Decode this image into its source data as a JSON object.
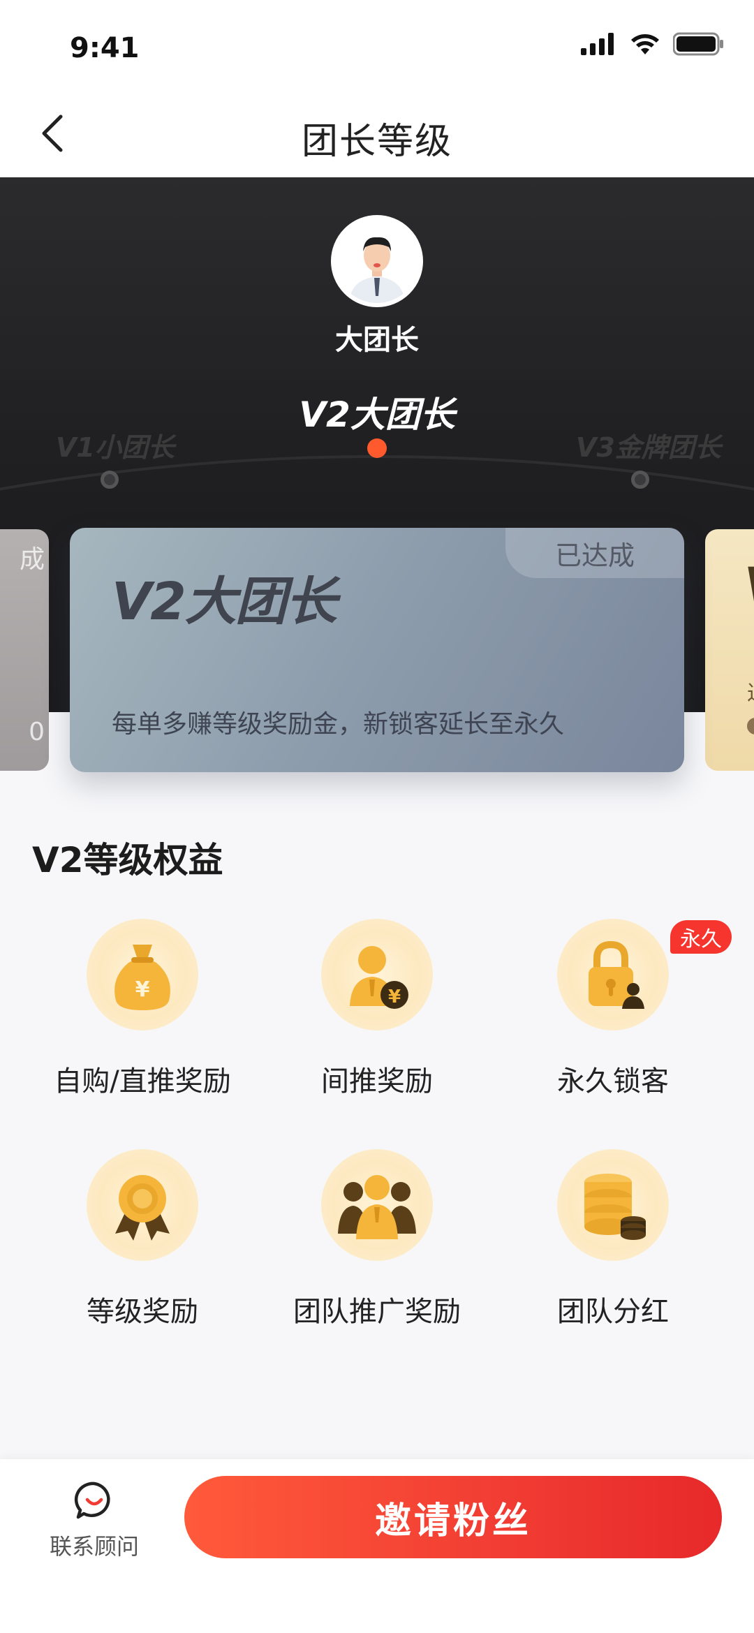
{
  "status": {
    "time": "9:41"
  },
  "nav": {
    "title": "团长等级"
  },
  "hero": {
    "avatar_name": "大团长",
    "current_level": "V2大团长",
    "prev_level": "V1小团长",
    "next_level": "V3金牌团长"
  },
  "card": {
    "badge": "已达成",
    "title": "V2大团长",
    "description": "每单多赚等级奖励金，新锁客延长至永久",
    "peek_left_char": "成",
    "peek_left_num": "0",
    "peek_right_v": "V",
    "peek_right_text": "过"
  },
  "benefits": {
    "title": "V2等级权益",
    "items": [
      {
        "label": "自购/直推奖励",
        "icon": "money-bag-icon"
      },
      {
        "label": "间推奖励",
        "icon": "person-coin-icon"
      },
      {
        "label": "永久锁客",
        "icon": "lock-person-icon",
        "tag": "永久"
      },
      {
        "label": "等级奖励",
        "icon": "medal-icon"
      },
      {
        "label": "团队推广奖励",
        "icon": "team-icon"
      },
      {
        "label": "团队分红",
        "icon": "coin-stack-icon"
      }
    ]
  },
  "bottom": {
    "contact_label": "联系顾问",
    "invite_label": "邀请粉丝"
  },
  "colors": {
    "accent": "#f13c33",
    "dot_active": "#ff5a2d",
    "gold": "#f5b53a"
  }
}
